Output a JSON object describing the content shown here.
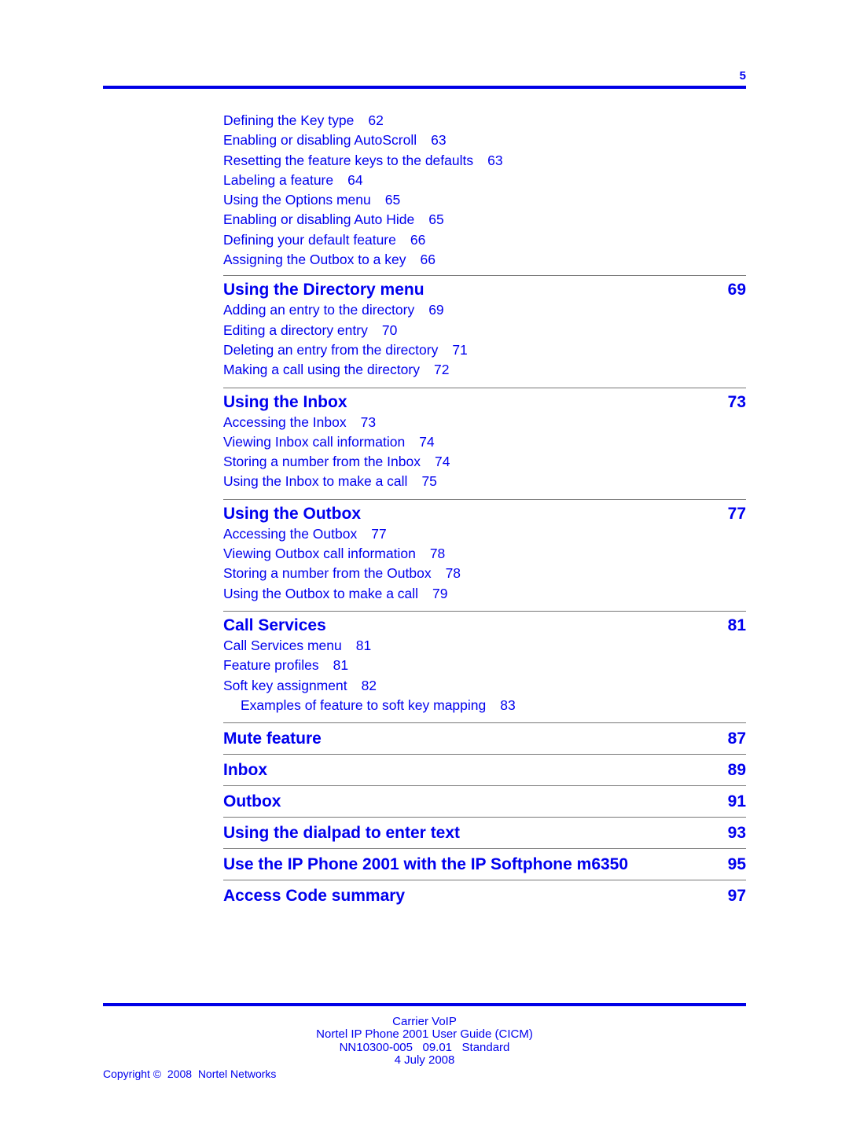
{
  "header": {
    "page_number": "5"
  },
  "toc": {
    "continued_items": [
      {
        "title": "Defining the Key type",
        "page": "62"
      },
      {
        "title": "Enabling or disabling AutoScroll",
        "page": "63"
      },
      {
        "title": "Resetting the feature keys to the defaults",
        "page": "63"
      },
      {
        "title": "Labeling a feature",
        "page": "64"
      },
      {
        "title": "Using the Options menu",
        "page": "65"
      },
      {
        "title": "Enabling or disabling Auto Hide",
        "page": "65"
      },
      {
        "title": "Defining your default feature",
        "page": "66"
      },
      {
        "title": "Assigning the Outbox to a key",
        "page": "66"
      }
    ],
    "chapters": [
      {
        "title": "Using the Directory menu",
        "page": "69",
        "items": [
          {
            "title": "Adding an entry to the directory",
            "page": "69"
          },
          {
            "title": "Editing a directory entry",
            "page": "70"
          },
          {
            "title": "Deleting an entry from the directory",
            "page": "71"
          },
          {
            "title": "Making a call using the directory",
            "page": "72"
          }
        ]
      },
      {
        "title": "Using the Inbox",
        "page": "73",
        "items": [
          {
            "title": "Accessing the Inbox",
            "page": "73"
          },
          {
            "title": "Viewing Inbox call information",
            "page": "74"
          },
          {
            "title": "Storing a number from the Inbox",
            "page": "74"
          },
          {
            "title": "Using the Inbox to make a call",
            "page": "75"
          }
        ]
      },
      {
        "title": "Using the Outbox",
        "page": "77",
        "items": [
          {
            "title": "Accessing the Outbox",
            "page": "77"
          },
          {
            "title": "Viewing Outbox call information",
            "page": "78"
          },
          {
            "title": "Storing a number from the Outbox",
            "page": "78"
          },
          {
            "title": "Using the Outbox to make a call",
            "page": "79"
          }
        ]
      },
      {
        "title": "Call Services",
        "page": "81",
        "items": [
          {
            "title": "Call Services menu",
            "page": "81"
          },
          {
            "title": "Feature profiles",
            "page": "81"
          },
          {
            "title": "Soft key assignment",
            "page": "82"
          },
          {
            "title": "Examples of feature to soft key mapping",
            "page": "83"
          }
        ]
      },
      {
        "title": "Mute feature",
        "page": "87"
      },
      {
        "title": "Inbox",
        "page": "89"
      },
      {
        "title": "Outbox",
        "page": "91"
      },
      {
        "title": "Using the dialpad to enter text",
        "page": "93"
      },
      {
        "title": "Use the IP Phone 2001 with the IP Softphone m6350",
        "page": "95"
      },
      {
        "title": "Access Code summary",
        "page": "97"
      }
    ]
  },
  "footer": {
    "line1": "Carrier VoIP",
    "line2": "Nortel IP Phone 2001 User Guide (CICM)",
    "line3": "NN10300-005   09.01   Standard",
    "line4": "4 July 2008",
    "copyright": "Copyright ©  2008  Nortel Networks"
  },
  "colors": {
    "link": "#0000ee",
    "rule": "#0000e6",
    "divider": "#777777"
  }
}
